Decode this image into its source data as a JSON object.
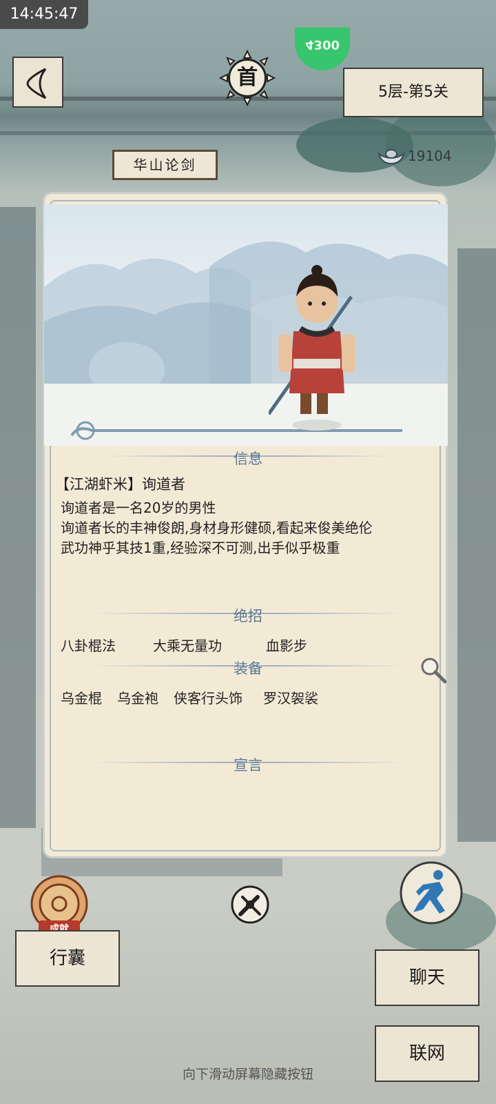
{
  "status_bar": {
    "time": "14:45:47"
  },
  "header": {
    "back_icon": "back-chevron-icon",
    "home_label": "首",
    "level_label": "5层-第5关",
    "silver_count": "19104",
    "green_badge_text": "4300"
  },
  "location_sign": {
    "title": "华山论剑"
  },
  "profile": {
    "section_info": "信息",
    "name_line": "【江湖虾米】询道者",
    "desc_lines": [
      "询道者是一名20岁的男性",
      "询道者长的丰神俊朗,身材身形健硕,看起来俊美绝伦",
      "武功神乎其技1重,经验深不可测,出手似乎极重"
    ],
    "section_skills": "绝招",
    "skills": [
      "八卦棍法",
      "大乘无量功",
      "血影步"
    ],
    "section_equip": "装备",
    "equipment": [
      "乌金棍",
      "乌金袍",
      "侠客行头饰",
      "罗汉袈裟"
    ],
    "section_manifesto": "宣言"
  },
  "bottom": {
    "achievement_label": "成就",
    "bag_label": "行囊",
    "chat_label": "聊天",
    "network_label": "联网",
    "hint": "向下滑动屏幕隐藏按钮"
  },
  "colors": {
    "accent_blue": "#5d7893",
    "card_bg": "#f3ead6",
    "green": "#37c56d"
  }
}
